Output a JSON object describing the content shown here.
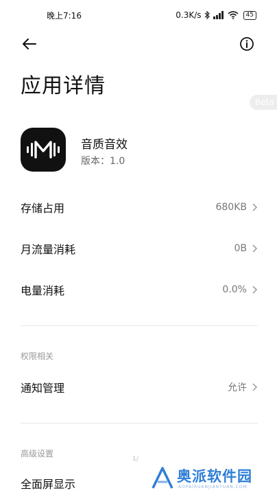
{
  "status_bar": {
    "time": "晚上7:16",
    "net_speed": "0.3K/s",
    "battery": "45"
  },
  "header": {
    "title": "应用详情",
    "badge": "Beta"
  },
  "app": {
    "name": "音质音效",
    "version": "版本：1.0"
  },
  "rows": [
    {
      "label": "存储占用",
      "value": "680KB"
    },
    {
      "label": "月流量消耗",
      "value": "0B"
    },
    {
      "label": "电量消耗",
      "value": "0.0%"
    }
  ],
  "permissions": {
    "section_label": "权限相关",
    "items": [
      {
        "label": "通知管理",
        "value": "允许"
      }
    ]
  },
  "advanced": {
    "section_label": "高级设置",
    "items": [
      {
        "label": "全面屏显示"
      }
    ]
  },
  "pager": "1/",
  "watermark": {
    "text": "奥派软件园",
    "sub": "AOPAIRUANJIANYUAN.COM"
  }
}
